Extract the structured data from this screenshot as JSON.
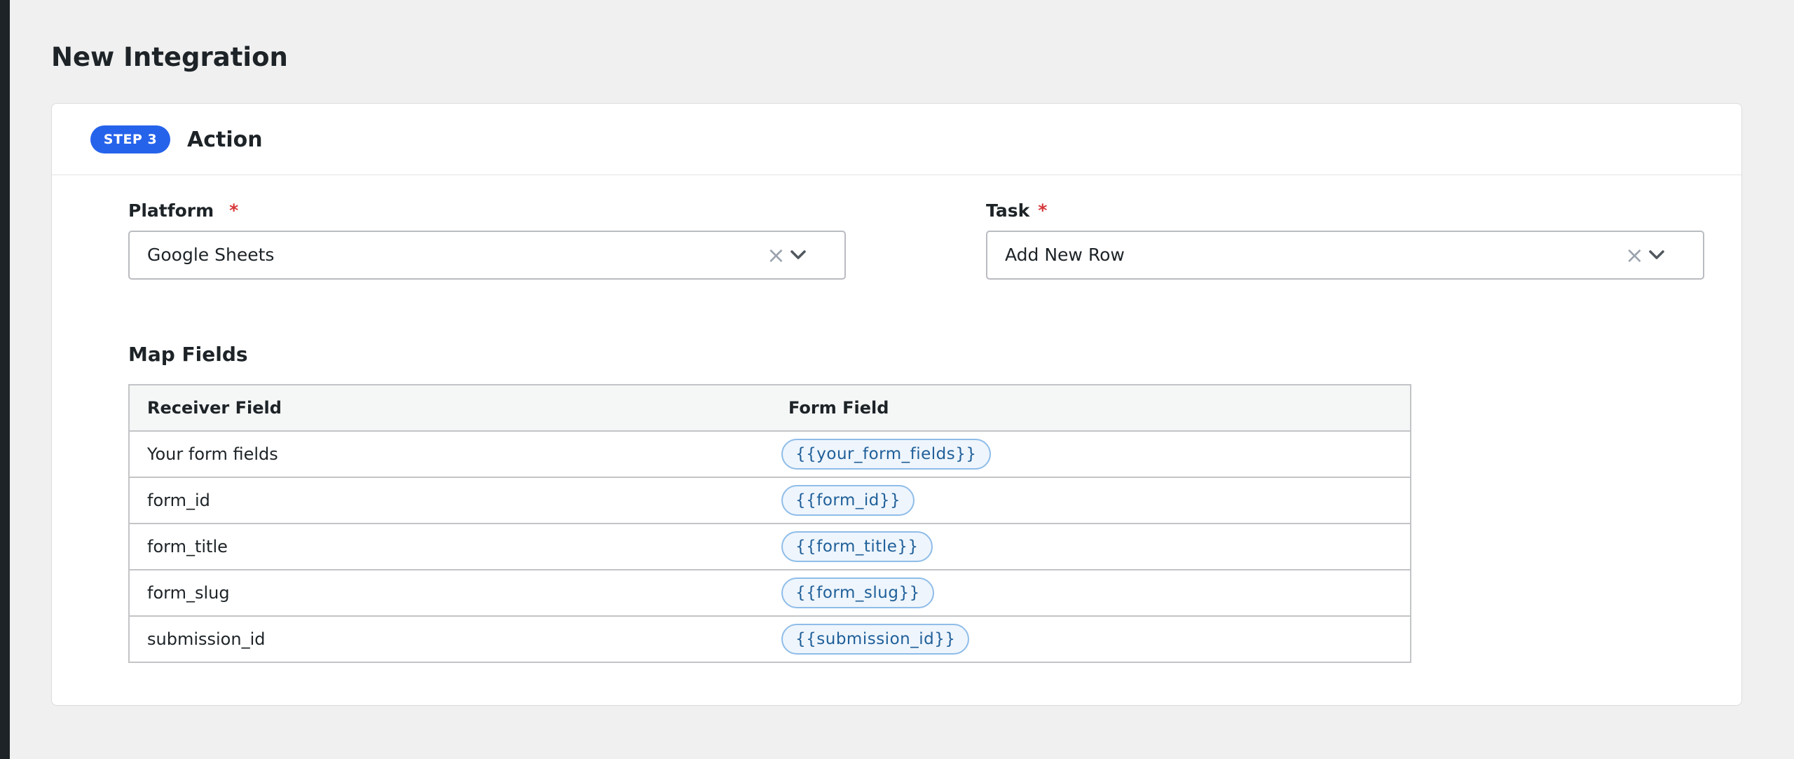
{
  "page": {
    "title": "New Integration"
  },
  "step": {
    "badge": "STEP 3",
    "title": "Action"
  },
  "platform": {
    "label": "Platform",
    "required_mark": "*",
    "value": "Google Sheets"
  },
  "task": {
    "label": "Task",
    "required_mark": "*",
    "value": "Add New Row"
  },
  "map_fields": {
    "title": "Map Fields",
    "headers": {
      "receiver": "Receiver Field",
      "form": "Form Field"
    },
    "rows": [
      {
        "receiver": "Your form fields",
        "form": "{{your_form_fields}}"
      },
      {
        "receiver": "form_id",
        "form": "{{form_id}}"
      },
      {
        "receiver": "form_title",
        "form": "{{form_title}}"
      },
      {
        "receiver": "form_slug",
        "form": "{{form_slug}}"
      },
      {
        "receiver": "submission_id",
        "form": "{{submission_id}}"
      }
    ]
  },
  "icons": {
    "clear": "×"
  },
  "colors": {
    "accent": "#2563eb",
    "required": "#d63638",
    "pill_border": "#8fbde9",
    "pill_text": "#1f5f99"
  }
}
